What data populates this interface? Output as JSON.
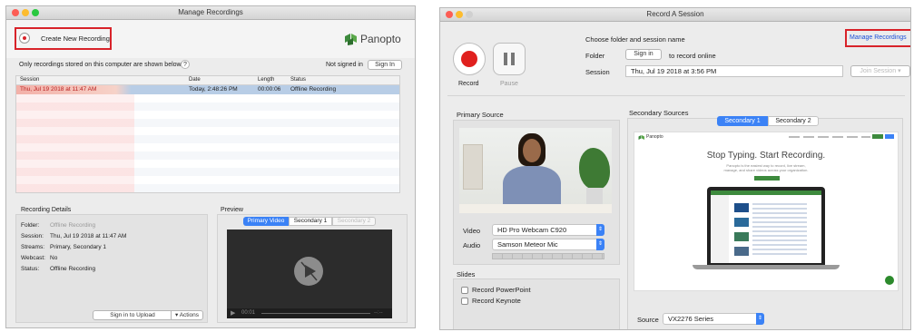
{
  "left": {
    "title": "Manage Recordings",
    "create_button": "Create New Recording",
    "logo_text": "Panopto",
    "info_text": "Only recordings stored on this computer are shown below.",
    "help_label": "?",
    "not_signed_in": "Not signed in",
    "sign_in_button": "Sign In",
    "columns": [
      "Session",
      "Date",
      "Length",
      "Status"
    ],
    "row": {
      "session": "Thu, Jul 19 2018 at 11:47 AM",
      "date": "Today, 2:48:26 PM",
      "length": "00:00:06",
      "status": "Offline Recording"
    },
    "details_title": "Recording Details",
    "details": [
      {
        "label": "Folder:",
        "value": "Offline Recording"
      },
      {
        "label": "Session:",
        "value": "Thu, Jul 19 2018 at 11:47 AM"
      },
      {
        "label": "Streams:",
        "value": "Primary, Secondary 1"
      },
      {
        "label": "Webcast:",
        "value": "No"
      },
      {
        "label": "Status:",
        "value": "Offline Recording"
      }
    ],
    "upload_button": "Sign in to Upload",
    "actions_button": "Actions",
    "preview_title": "Preview",
    "preview_tabs": [
      "Primary Video",
      "Secondary 1",
      "Secondary 2"
    ],
    "player_time": "00:01",
    "player_end": "--:--"
  },
  "right": {
    "title": "Record A Session",
    "record_label": "Record",
    "pause_label": "Pause",
    "choose_text": "Choose folder and session name",
    "manage_button": "Manage Recordings",
    "folder_label": "Folder",
    "sign_in_button": "Sign in",
    "record_online": "to record online",
    "session_label": "Session",
    "session_value": "Thu, Jul 19 2018 at 3:56 PM",
    "join_button": "Join Session",
    "primary_source": "Primary Source",
    "secondary_sources": "Secondary Sources",
    "sec_tabs": [
      "Secondary 1",
      "Secondary 2"
    ],
    "video_label": "Video",
    "video_value": "HD Pro Webcam C920",
    "audio_label": "Audio",
    "audio_value": "Samson Meteor Mic",
    "slides_title": "Slides",
    "slides_options": [
      "Record PowerPoint",
      "Record Keynote"
    ],
    "source_label": "Source",
    "source_value": "VX2276 Series",
    "screen": {
      "logo": "Panopto",
      "headline": "Stop Typing. Start Recording.",
      "sub1": "Panopto is the easiest way to record, live stream,",
      "sub2": "manage, and share videos across your organization."
    }
  },
  "colors": {
    "accent_red": "#d8232a",
    "selection_blue": "#b8cde6",
    "tab_blue": "#3b82f6",
    "brand_green": "#3d8a3d"
  }
}
